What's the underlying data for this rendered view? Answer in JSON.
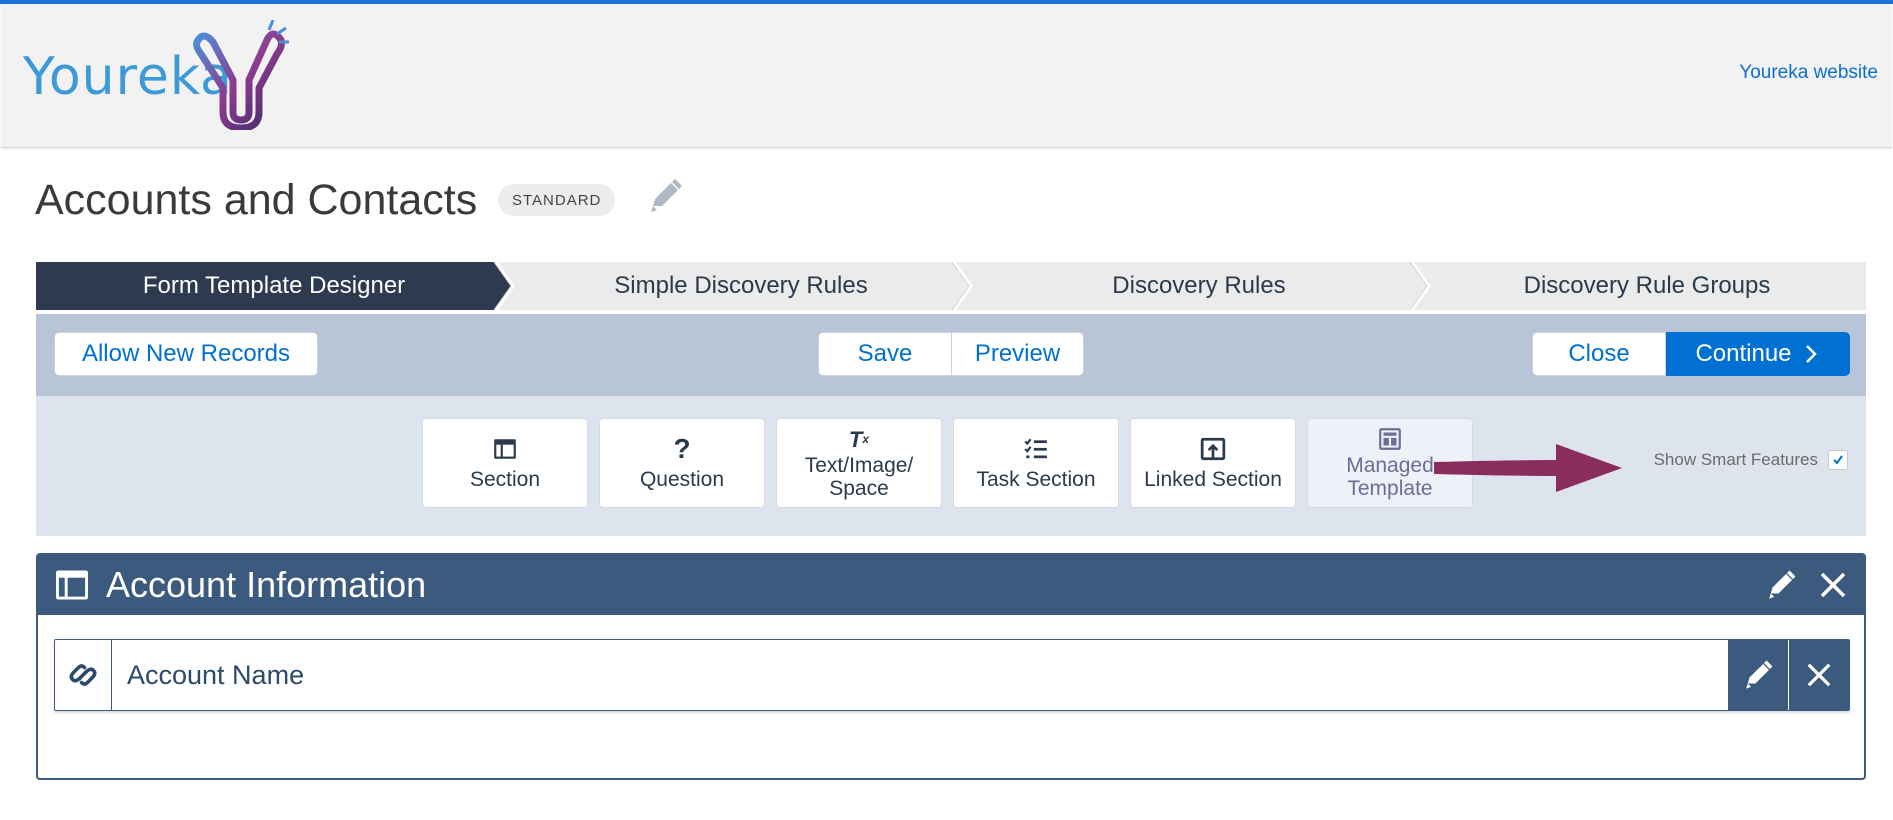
{
  "header": {
    "logo_text": "Youreka",
    "website_link": "Youreka website"
  },
  "page": {
    "title": "Accounts and Contacts",
    "badge": "STANDARD"
  },
  "path": {
    "steps": [
      {
        "label": "Form Template Designer",
        "active": true
      },
      {
        "label": "Simple Discovery Rules",
        "active": false
      },
      {
        "label": "Discovery Rules",
        "active": false
      },
      {
        "label": "Discovery Rule Groups",
        "active": false
      }
    ]
  },
  "toolbar": {
    "allow_new_records": "Allow New Records",
    "save": "Save",
    "preview": "Preview",
    "close": "Close",
    "continue": "Continue",
    "continue_icon": "chevron-right-icon"
  },
  "palette": {
    "tiles": [
      {
        "label": "Section",
        "icon": "section-icon"
      },
      {
        "label": "Question",
        "icon": "question-icon"
      },
      {
        "label": "Text/Image/\nSpace",
        "icon": "text-format-icon"
      },
      {
        "label": "Task Section",
        "icon": "checklist-icon"
      },
      {
        "label": "Linked Section",
        "icon": "linked-section-icon"
      },
      {
        "label": "Managed\nTemplate",
        "icon": "template-icon"
      }
    ],
    "smart_features_label": "Show Smart Features",
    "smart_features_checked": true
  },
  "section": {
    "title": "Account Information",
    "question": {
      "label": "Account Name",
      "icon": "link-icon"
    }
  },
  "colors": {
    "accent": "#0070d2",
    "path_active": "#2e3a4f",
    "section_header": "#3b5a7e",
    "arrow": "#8b2d5c"
  }
}
